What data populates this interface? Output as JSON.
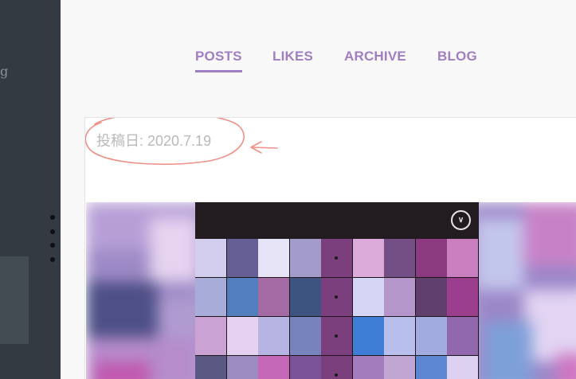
{
  "sidebar": {
    "text_fragment": "g"
  },
  "nav": {
    "items": [
      {
        "label": "POSTS",
        "active": true
      },
      {
        "label": "LIKES",
        "active": false
      },
      {
        "label": "ARCHIVE",
        "active": false
      },
      {
        "label": "BLOG",
        "active": false
      }
    ],
    "color": "#a07ec2"
  },
  "post": {
    "date_text": "投稿日: 2020.7.19",
    "annotation_color": "#ef8f86"
  },
  "media": {
    "chevron_icon": "chevron-down-icon",
    "grid_colors": [
      [
        "#d2cdec",
        "#665f95",
        "#e8e4f8",
        "#a39ccb",
        "#7c3f7d",
        "#dcaad9",
        "#744f85",
        "#8c3a7f",
        "#c97fc0"
      ],
      [
        "#a7acd9",
        "#527dbf",
        "#a46aa4",
        "#3e5480",
        "#7c3f7d",
        "#d5d5f6",
        "#b596ca",
        "#613f6d",
        "#9a3e8d"
      ],
      [
        "#cba2d4",
        "#e5d2f1",
        "#b5b4e2",
        "#7683bc",
        "#7c3f7d",
        "#3f7ed7",
        "#b9bfed",
        "#a1abde",
        "#9068ab"
      ],
      [
        "#5b5983",
        "#9b8bc1",
        "#c567b7",
        "#7a5496",
        "#7c3f7d",
        "#a37cbe",
        "#c1a6d4",
        "#5d87d3",
        "#dcd1f0"
      ]
    ],
    "grid_dots_column": 4
  }
}
